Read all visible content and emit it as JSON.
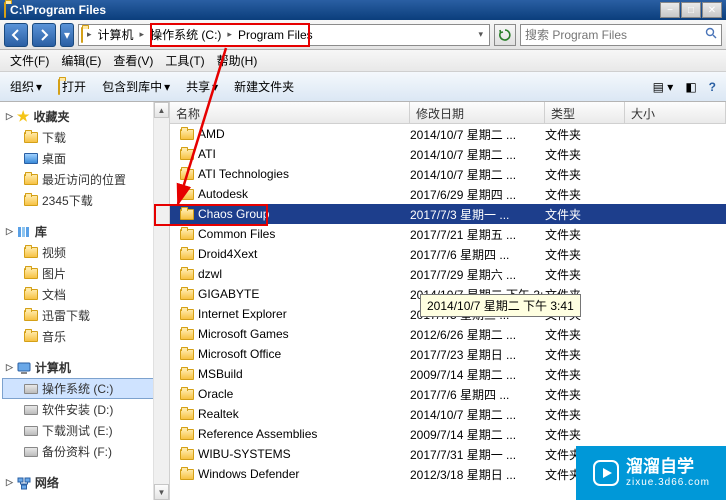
{
  "window": {
    "title": "C:\\Program Files"
  },
  "breadcrumb": {
    "items": [
      "计算机",
      "操作系统 (C:)",
      "Program Files"
    ]
  },
  "search": {
    "placeholder": "搜索 Program Files"
  },
  "menubar": {
    "file": "文件(F)",
    "edit": "编辑(E)",
    "view": "查看(V)",
    "tools": "工具(T)",
    "help": "帮助(H)"
  },
  "toolbar": {
    "organize": "组织",
    "open": "打开",
    "include": "包含到库中",
    "share": "共享",
    "newfolder": "新建文件夹"
  },
  "columns": {
    "name": "名称",
    "date": "修改日期",
    "type": "类型",
    "size": "大小"
  },
  "sidebar": {
    "favorites": {
      "title": "收藏夹",
      "items": [
        "下载",
        "桌面",
        "最近访问的位置",
        "2345下载"
      ]
    },
    "libraries": {
      "title": "库",
      "items": [
        "视频",
        "图片",
        "文档",
        "迅雷下载",
        "音乐"
      ]
    },
    "computer": {
      "title": "计算机",
      "items": [
        "操作系统 (C:)",
        "软件安装 (D:)",
        "下载测试 (E:)",
        "备份资料 (F:)"
      ]
    },
    "network": {
      "title": "网络"
    }
  },
  "type_folder": "文件夹",
  "files": [
    {
      "name": "AMD",
      "date": "2014/10/7 星期二 ...",
      "type": "文件夹"
    },
    {
      "name": "ATI",
      "date": "2014/10/7 星期二 ...",
      "type": "文件夹"
    },
    {
      "name": "ATI Technologies",
      "date": "2014/10/7 星期二 ...",
      "type": "文件夹"
    },
    {
      "name": "Autodesk",
      "date": "2017/6/29 星期四 ...",
      "type": "文件夹"
    },
    {
      "name": "Chaos Group",
      "date": "2017/7/3 星期一 ...",
      "type": "文件夹",
      "selected": true
    },
    {
      "name": "Common Files",
      "date": "2017/7/21 星期五 ...",
      "type": "文件夹"
    },
    {
      "name": "Droid4Xext",
      "date": "2017/7/6 星期四 ...",
      "type": "文件夹"
    },
    {
      "name": "dzwl",
      "date": "2017/7/29 星期六 ...",
      "type": "文件夹"
    },
    {
      "name": "GIGABYTE",
      "date": "2014/10/7 星期二 下午 3:41",
      "type": "文件夹",
      "tooltip": true
    },
    {
      "name": "Internet Explorer",
      "date": "2017/7/5 星期三 ...",
      "type": "文件夹"
    },
    {
      "name": "Microsoft Games",
      "date": "2012/6/26 星期二 ...",
      "type": "文件夹"
    },
    {
      "name": "Microsoft Office",
      "date": "2017/7/23 星期日 ...",
      "type": "文件夹"
    },
    {
      "name": "MSBuild",
      "date": "2009/7/14 星期二 ...",
      "type": "文件夹"
    },
    {
      "name": "Oracle",
      "date": "2017/7/6 星期四 ...",
      "type": "文件夹"
    },
    {
      "name": "Realtek",
      "date": "2014/10/7 星期二 ...",
      "type": "文件夹"
    },
    {
      "name": "Reference Assemblies",
      "date": "2009/7/14 星期二 ...",
      "type": "文件夹"
    },
    {
      "name": "WIBU-SYSTEMS",
      "date": "2017/7/31 星期一 ...",
      "type": "文件夹"
    },
    {
      "name": "Windows Defender",
      "date": "2012/3/18 星期日 ...",
      "type": "文件夹"
    }
  ],
  "tooltip_text": "2014/10/7 星期二 下午 3:41",
  "watermark": {
    "big": "溜溜自学",
    "small": "zixue.3d66.com"
  }
}
